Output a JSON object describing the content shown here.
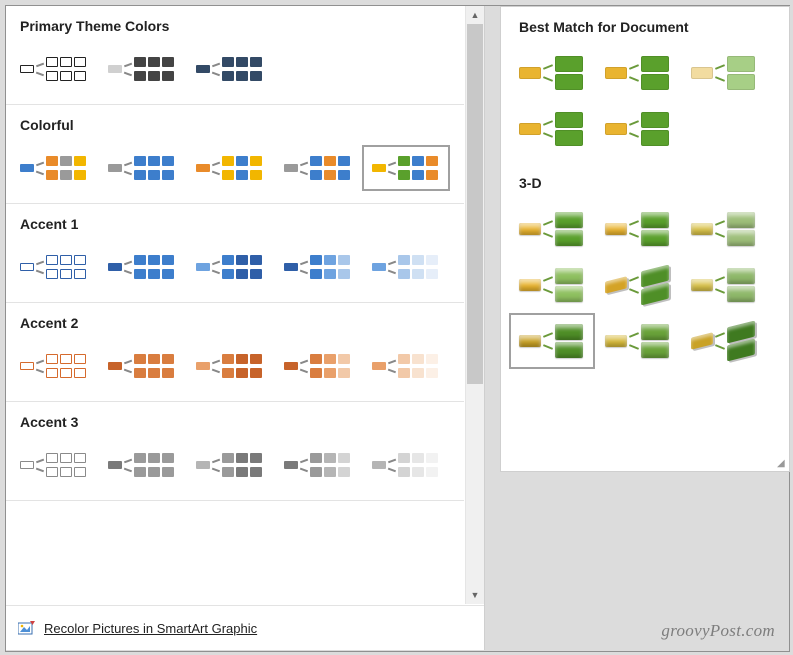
{
  "left": {
    "sections": [
      {
        "title": "Primary Theme Colors",
        "items": [
          {
            "outline": true,
            "colors": [
              "#222",
              "#222",
              "#222",
              "#222"
            ]
          },
          {
            "colors": [
              "#d0d0d0",
              "#444",
              "#444",
              "#444"
            ]
          },
          {
            "colors": [
              "#334a66",
              "#334a66",
              "#334a66",
              "#334a66"
            ]
          }
        ]
      },
      {
        "title": "Colorful",
        "items": [
          {
            "colors": [
              "#3d7ecc",
              "#e98b2a",
              "#9a9a9a",
              "#f2b600"
            ]
          },
          {
            "colors": [
              "#9a9a9a",
              "#3d7ecc",
              "#3d7ecc",
              "#3d7ecc"
            ]
          },
          {
            "colors": [
              "#e98b2a",
              "#f2b600",
              "#3d7ecc",
              "#f2b600"
            ]
          },
          {
            "colors": [
              "#9a9a9a",
              "#3d7ecc",
              "#e98b2a",
              "#3d7ecc"
            ]
          },
          {
            "selected": true,
            "colors": [
              "#f2b600",
              "#5aa02c",
              "#3d7ecc",
              "#e98b2a"
            ]
          }
        ]
      },
      {
        "title": "Accent 1",
        "items": [
          {
            "outline": true,
            "colors": [
              "#2f5fa8",
              "#2f5fa8",
              "#2f5fa8",
              "#2f5fa8"
            ]
          },
          {
            "colors": [
              "#2f5fa8",
              "#3d7ecc",
              "#3d7ecc",
              "#3d7ecc"
            ]
          },
          {
            "colors": [
              "#6ea3e0",
              "#3d7ecc",
              "#2f5fa8",
              "#2f5fa8"
            ]
          },
          {
            "colors": [
              "#2f5fa8",
              "#3d7ecc",
              "#6ea3e0",
              "#a9c7ea"
            ]
          },
          {
            "colors": [
              "#6ea3e0",
              "#a9c7ea",
              "#cfe0f3",
              "#e6eef9"
            ]
          }
        ]
      },
      {
        "title": "Accent 2",
        "items": [
          {
            "outline": true,
            "colors": [
              "#d56a2d",
              "#d56a2d",
              "#d56a2d",
              "#d56a2d"
            ]
          },
          {
            "colors": [
              "#c7632a",
              "#d97d3f",
              "#d97d3f",
              "#d97d3f"
            ]
          },
          {
            "colors": [
              "#e9a06a",
              "#d97d3f",
              "#c7632a",
              "#c7632a"
            ]
          },
          {
            "colors": [
              "#c7632a",
              "#d97d3f",
              "#e9a06a",
              "#f2c9a8"
            ]
          },
          {
            "colors": [
              "#e9a06a",
              "#f2c9a8",
              "#f8e2cf",
              "#fcf0e6"
            ]
          }
        ]
      },
      {
        "title": "Accent 3",
        "items": [
          {
            "outline": true,
            "colors": [
              "#8a8a8a",
              "#8a8a8a",
              "#8a8a8a",
              "#8a8a8a"
            ]
          },
          {
            "colors": [
              "#7a7a7a",
              "#9a9a9a",
              "#9a9a9a",
              "#9a9a9a"
            ]
          },
          {
            "colors": [
              "#b5b5b5",
              "#9a9a9a",
              "#7a7a7a",
              "#7a7a7a"
            ]
          },
          {
            "colors": [
              "#7a7a7a",
              "#9a9a9a",
              "#b5b5b5",
              "#d4d4d4"
            ]
          },
          {
            "colors": [
              "#b5b5b5",
              "#d4d4d4",
              "#e6e6e6",
              "#f2f2f2"
            ]
          }
        ]
      }
    ],
    "footer": {
      "label": "Recolor Pictures in SmartArt Graphic",
      "accel_index": 0
    }
  },
  "right": {
    "sections": [
      {
        "title": "Best Match for Document",
        "style": "flat",
        "items": [
          {
            "lead": "#e9b430",
            "blocks": "#5aa02c"
          },
          {
            "lead": "#e9b430",
            "blocks": "#5aa02c"
          },
          {
            "lead": "#f2dca0",
            "blocks": "#a7cf86"
          },
          {
            "lead": "#e9b430",
            "blocks": "#5aa02c"
          },
          {
            "lead": "#e9b430",
            "blocks": "#5aa02c"
          }
        ]
      },
      {
        "title": "3-D",
        "style": "threed",
        "items": [
          {
            "lead": "#e9b430",
            "blocks": "#5aa02c"
          },
          {
            "lead": "#e9b430",
            "blocks": "#5aa02c"
          },
          {
            "lead": "#d9c24a",
            "blocks": "#9ebf7a"
          },
          {
            "lead": "#e9b430",
            "blocks": "#8fc060"
          },
          {
            "lead": "#d4a326",
            "blocks": "#4f8f27",
            "iso": true
          },
          {
            "lead": "#d9c24a",
            "blocks": "#8fb86a"
          },
          {
            "selected": true,
            "lead": "#c9a227",
            "blocks": "#4f8f27"
          },
          {
            "lead": "#d6b93a",
            "blocks": "#6aa33a"
          },
          {
            "lead": "#c9a227",
            "blocks": "#3f7a20",
            "iso": true
          }
        ]
      }
    ]
  },
  "watermark": "groovyPost.com"
}
